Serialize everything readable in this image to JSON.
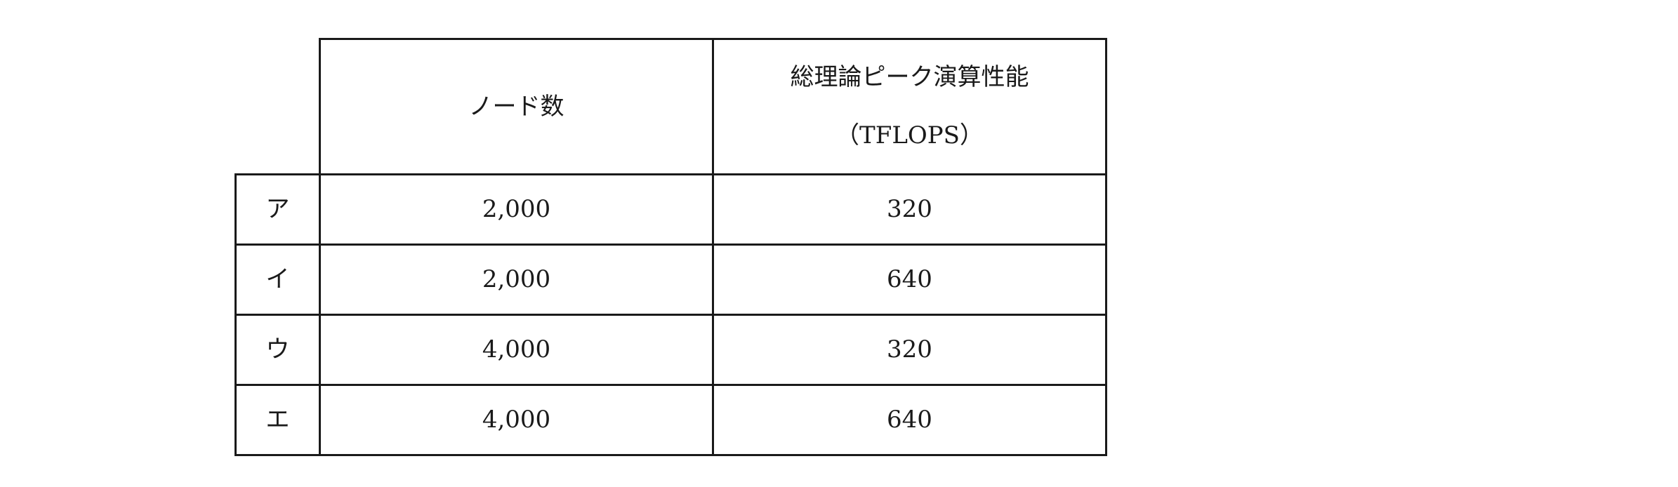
{
  "table": {
    "headers": {
      "nodes": "ノード数",
      "perf_line1": "総理論ピーク演算性能",
      "perf_line2": "（TFLOPS）"
    },
    "rows": [
      {
        "choice": "ア",
        "nodes": "2,000",
        "perf": "320"
      },
      {
        "choice": "イ",
        "nodes": "2,000",
        "perf": "640"
      },
      {
        "choice": "ウ",
        "nodes": "4,000",
        "perf": "320"
      },
      {
        "choice": "エ",
        "nodes": "4,000",
        "perf": "640"
      }
    ]
  }
}
